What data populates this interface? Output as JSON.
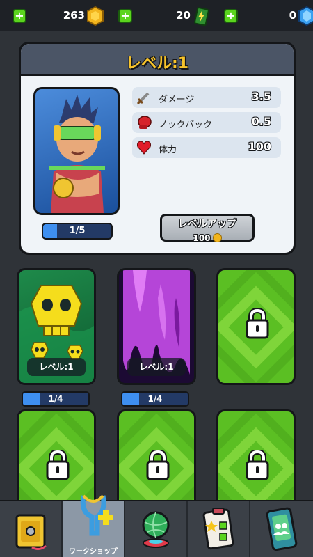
{
  "currencies": [
    {
      "name": "coins",
      "value": "263",
      "icon": "gold-coin-icon"
    },
    {
      "name": "energy",
      "value": "20",
      "icon": "battery-icon"
    },
    {
      "name": "gems",
      "value": "0",
      "icon": "blue-gem-icon"
    }
  ],
  "level_panel": {
    "title": "レベル:1",
    "hero_progress": {
      "text": "1/5",
      "fraction": 0.2
    },
    "stats": [
      {
        "icon": "sword-icon",
        "label": "ダメージ",
        "value": "3.5"
      },
      {
        "icon": "boxing-glove-icon",
        "label": "ノックバック",
        "value": "0.5"
      },
      {
        "icon": "heart-icon",
        "label": "体力",
        "value": "100"
      }
    ],
    "level_up_button": {
      "label": "レベルアップ",
      "cost": "100"
    }
  },
  "cards": [
    {
      "type": "skull",
      "label": "レベル:1",
      "progress": {
        "text": "1/4",
        "fraction": 0.25
      }
    },
    {
      "type": "slime",
      "label": "レベル:1",
      "progress": {
        "text": "1/4",
        "fraction": 0.25
      }
    },
    {
      "type": "locked"
    },
    {
      "type": "locked"
    },
    {
      "type": "locked"
    },
    {
      "type": "locked"
    }
  ],
  "nav": [
    {
      "icon": "treasure-chest-icon",
      "label": ""
    },
    {
      "icon": "slingshot-icon",
      "label": "ワークショップ",
      "active": true
    },
    {
      "icon": "globe-icon",
      "label": ""
    },
    {
      "icon": "checklist-icon",
      "label": ""
    },
    {
      "icon": "social-tablet-icon",
      "label": ""
    }
  ],
  "colors": {
    "accent_green": "#5bd41e",
    "title_yellow": "#f7c32b",
    "progress_blue": "#3e8ff0"
  }
}
